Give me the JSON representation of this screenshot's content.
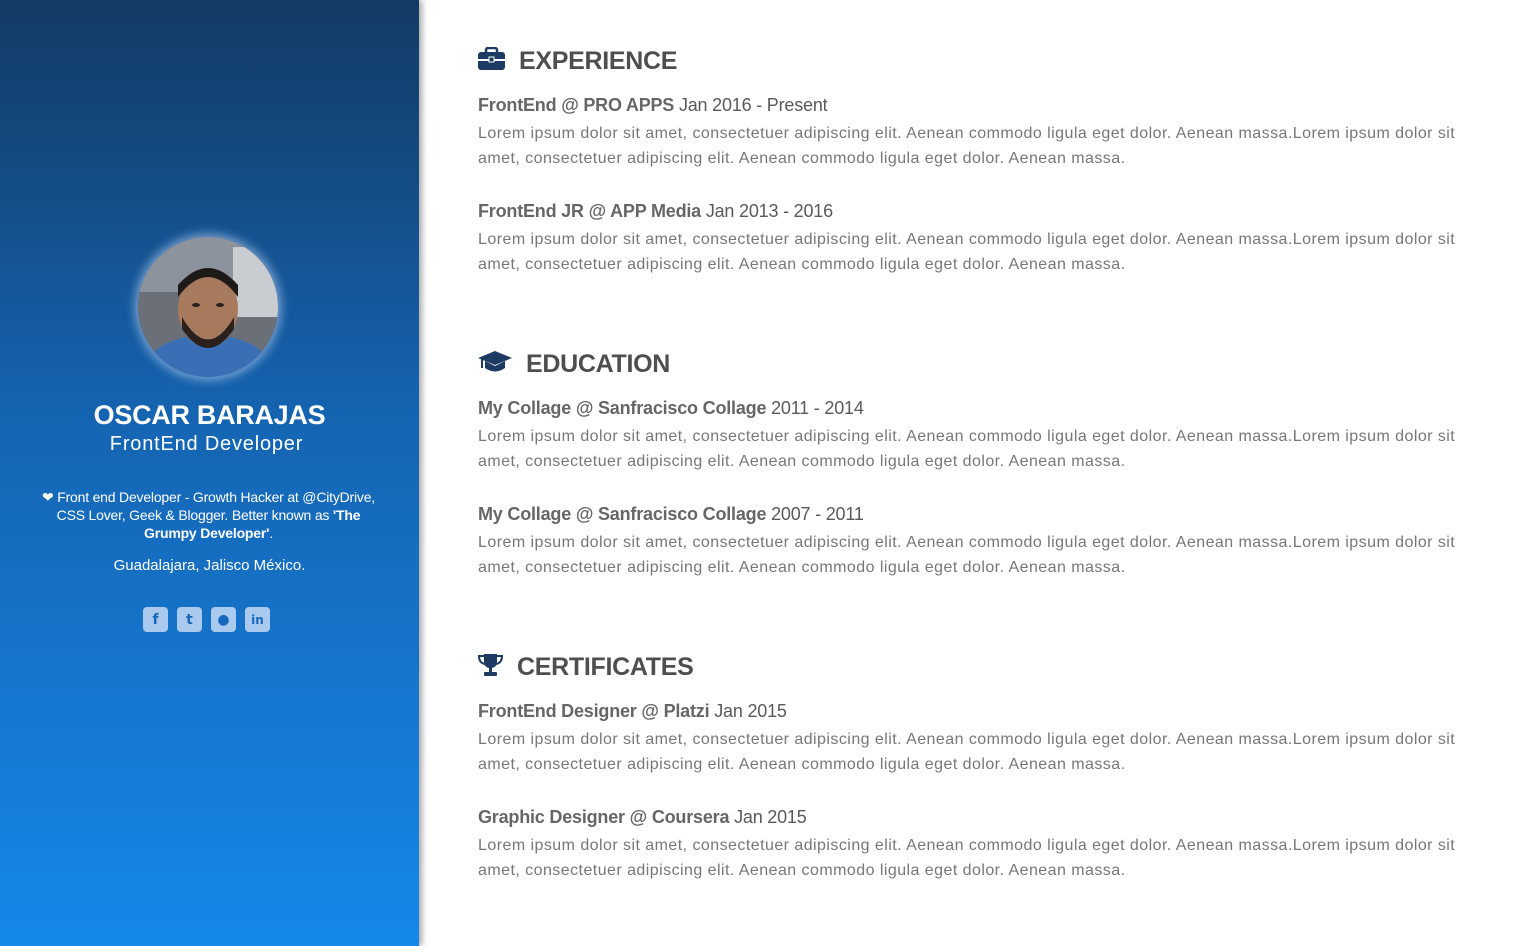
{
  "profile": {
    "name": "OSCAR BARAJAS",
    "title": "FrontEnd Developer",
    "bio_heart": "❤",
    "bio_text": " Front end Developer - Growth Hacker at @CityDrive, CSS Lover, Geek & Blogger. Better known as ",
    "bio_nickname": "'The Grumpy Developer'",
    "bio_end": ".",
    "location": "Guadalajara, Jalisco México."
  },
  "socials": [
    {
      "icon": "facebook-icon",
      "glyph": "f"
    },
    {
      "icon": "twitter-icon",
      "glyph": "t"
    },
    {
      "icon": "github-icon",
      "glyph": "●"
    },
    {
      "icon": "linkedin-icon",
      "glyph": "in"
    }
  ],
  "sections": {
    "experience": {
      "title": "EXPERIENCE",
      "icon": "briefcase-icon",
      "entries": [
        {
          "role": "FrontEnd",
          "org": "PRO APPS",
          "dates": "Jan 2016 - Present",
          "desc": "Lorem ipsum dolor sit amet, consectetuer adipiscing elit. Aenean commodo ligula eget dolor. Aenean massa.Lorem ipsum dolor sit amet, consectetuer adipiscing elit. Aenean commodo ligula eget dolor. Aenean massa."
        },
        {
          "role": "FrontEnd JR",
          "org": "APP Media",
          "dates": "Jan 2013 - 2016",
          "desc": "Lorem ipsum dolor sit amet, consectetuer adipiscing elit. Aenean commodo ligula eget dolor. Aenean massa.Lorem ipsum dolor sit amet, consectetuer adipiscing elit. Aenean commodo ligula eget dolor. Aenean massa."
        }
      ]
    },
    "education": {
      "title": "EDUCATION",
      "icon": "graduation-cap-icon",
      "entries": [
        {
          "role": "My Collage",
          "org": "Sanfracisco Collage",
          "dates": "2011 - 2014",
          "desc": "Lorem ipsum dolor sit amet, consectetuer adipiscing elit. Aenean commodo ligula eget dolor. Aenean massa.Lorem ipsum dolor sit amet, consectetuer adipiscing elit. Aenean commodo ligula eget dolor. Aenean massa."
        },
        {
          "role": "My Collage",
          "org": "Sanfracisco Collage",
          "dates": "2007 - 2011",
          "desc": "Lorem ipsum dolor sit amet, consectetuer adipiscing elit. Aenean commodo ligula eget dolor. Aenean massa.Lorem ipsum dolor sit amet, consectetuer adipiscing elit. Aenean commodo ligula eget dolor. Aenean massa."
        }
      ]
    },
    "certificates": {
      "title": "CERTIFICATES",
      "icon": "trophy-icon",
      "entries": [
        {
          "role": "FrontEnd Designer",
          "org": "Platzi",
          "dates": "Jan 2015",
          "desc": "Lorem ipsum dolor sit amet, consectetuer adipiscing elit. Aenean commodo ligula eget dolor. Aenean massa.Lorem ipsum dolor sit amet, consectetuer adipiscing elit. Aenean commodo ligula eget dolor. Aenean massa."
        },
        {
          "role": "Graphic Designer",
          "org": "Coursera",
          "dates": "Jan 2015",
          "desc": "Lorem ipsum dolor sit amet, consectetuer adipiscing elit. Aenean commodo ligula eget dolor. Aenean massa.Lorem ipsum dolor sit amet, consectetuer adipiscing elit. Aenean commodo ligula eget dolor. Aenean massa."
        }
      ]
    }
  },
  "separator": " @ ",
  "colors": {
    "sidebar_top": "#133a64",
    "sidebar_bottom": "#1588e9",
    "icon_navy": "#1d3a62",
    "heading_text": "#4e4e4e",
    "body_text": "#777777"
  }
}
